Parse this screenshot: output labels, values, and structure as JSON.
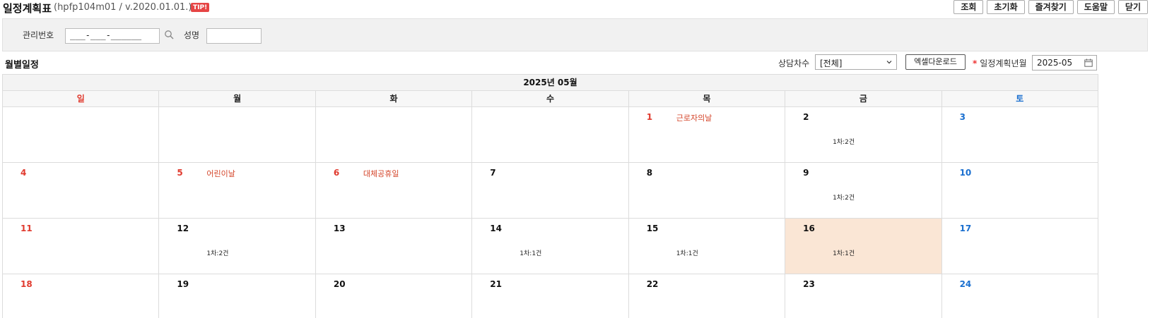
{
  "header": {
    "title": "일정계획표",
    "program_id": "(hpfp104m01 / v.2020.01.01.)",
    "tip": "TIP!",
    "buttons": [
      "조회",
      "초기화",
      "즐겨찾기",
      "도움말",
      "닫기"
    ]
  },
  "search": {
    "mgmt_label": "관리번호",
    "mgmt_value": "___-___-______",
    "name_label": "성명",
    "name_value": ""
  },
  "section": {
    "title": "월별일정",
    "session_label": "상담차수",
    "session_value": "[전체]",
    "excel_button": "엑셀다운로드",
    "required_mark": "*",
    "plan_month_label": "일정계획년월",
    "plan_month_value": "2025-05"
  },
  "calendar": {
    "month_title": "2025년 05월",
    "weekdays": [
      "일",
      "월",
      "화",
      "수",
      "목",
      "금",
      "토"
    ],
    "weeks": [
      [
        {
          "num": "",
          "color": "red",
          "holiday": "",
          "count": ""
        },
        {
          "num": "",
          "color": "",
          "holiday": "",
          "count": ""
        },
        {
          "num": "",
          "color": "",
          "holiday": "",
          "count": ""
        },
        {
          "num": "",
          "color": "",
          "holiday": "",
          "count": ""
        },
        {
          "num": "1",
          "color": "red",
          "holiday": "근로자의날",
          "count": ""
        },
        {
          "num": "2",
          "color": "",
          "holiday": "",
          "count": "1차:2건"
        },
        {
          "num": "3",
          "color": "blue",
          "holiday": "",
          "count": ""
        }
      ],
      [
        {
          "num": "4",
          "color": "red",
          "holiday": "",
          "count": ""
        },
        {
          "num": "5",
          "color": "red",
          "holiday": "어린이날",
          "count": ""
        },
        {
          "num": "6",
          "color": "red",
          "holiday": "대체공휴일",
          "count": ""
        },
        {
          "num": "7",
          "color": "",
          "holiday": "",
          "count": ""
        },
        {
          "num": "8",
          "color": "",
          "holiday": "",
          "count": ""
        },
        {
          "num": "9",
          "color": "",
          "holiday": "",
          "count": "1차:2건"
        },
        {
          "num": "10",
          "color": "blue",
          "holiday": "",
          "count": ""
        }
      ],
      [
        {
          "num": "11",
          "color": "red",
          "holiday": "",
          "count": ""
        },
        {
          "num": "12",
          "color": "",
          "holiday": "",
          "count": "1차:2건"
        },
        {
          "num": "13",
          "color": "",
          "holiday": "",
          "count": ""
        },
        {
          "num": "14",
          "color": "",
          "holiday": "",
          "count": "1차:1건"
        },
        {
          "num": "15",
          "color": "",
          "holiday": "",
          "count": "1차:1건"
        },
        {
          "num": "16",
          "color": "",
          "holiday": "",
          "count": "1차:1건",
          "today": true
        },
        {
          "num": "17",
          "color": "blue",
          "holiday": "",
          "count": ""
        }
      ],
      [
        {
          "num": "18",
          "color": "red",
          "holiday": "",
          "count": ""
        },
        {
          "num": "19",
          "color": "",
          "holiday": "",
          "count": ""
        },
        {
          "num": "20",
          "color": "",
          "holiday": "",
          "count": ""
        },
        {
          "num": "21",
          "color": "",
          "holiday": "",
          "count": ""
        },
        {
          "num": "22",
          "color": "",
          "holiday": "",
          "count": ""
        },
        {
          "num": "23",
          "color": "",
          "holiday": "",
          "count": ""
        },
        {
          "num": "24",
          "color": "blue",
          "holiday": "",
          "count": ""
        }
      ]
    ]
  },
  "colors": {
    "today_bg": "#fae6d5",
    "sunday_red": "#e03a2e",
    "saturday_blue": "#1a6fcf",
    "holiday_text": "#d4452a",
    "tip_badge": "#e64545"
  }
}
